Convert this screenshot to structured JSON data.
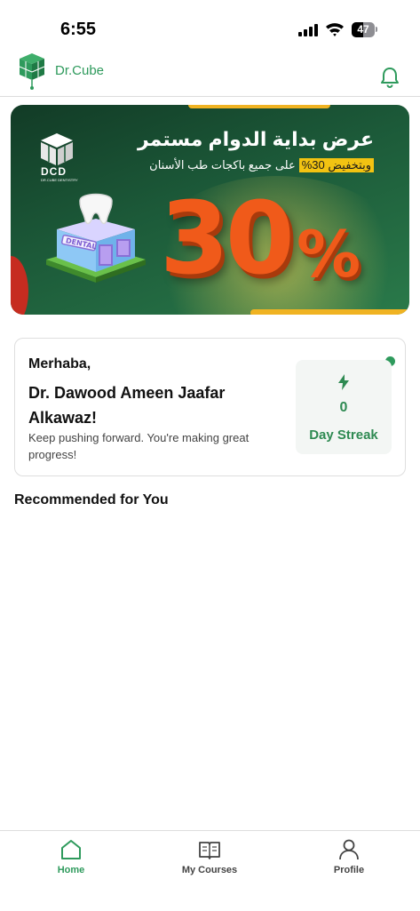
{
  "status_bar": {
    "time": "6:55",
    "battery": "47"
  },
  "header": {
    "brand": "Dr.Cube",
    "logo_icon": "dr-cube-logo",
    "notification_icon": "bell-icon"
  },
  "banner": {
    "brand_short": "DCD",
    "brand_small": "DR.CUBE DENTISTRY",
    "title": "عرض بداية الدوام مستمر",
    "subtitle_highlight": "وبتخفيض 30%",
    "subtitle_rest": "على جميع باكجات طب الأسنان",
    "big_number": "30",
    "percent_sign": "%",
    "building_label": "DENTAL",
    "colors": {
      "background": "#1c5a39",
      "accent": "#f05a1a",
      "highlight": "#f2c312"
    }
  },
  "greeting": {
    "salutation": "Merhaba,",
    "name": "Dr. Dawood Ameen Jaafar Alkawaz!",
    "message": "Keep pushing forward. You're making great progress!"
  },
  "streak": {
    "value": "0",
    "label": "Day Streak",
    "icon": "lightning-icon"
  },
  "sections": {
    "recommended": "Recommended for You"
  },
  "bottom_nav": [
    {
      "label": "Home",
      "icon": "home-icon",
      "active": true
    },
    {
      "label": "My Courses",
      "icon": "book-icon",
      "active": false
    },
    {
      "label": "Profile",
      "icon": "person-icon",
      "active": false
    }
  ],
  "colors": {
    "brand_green": "#2e9a5c"
  }
}
